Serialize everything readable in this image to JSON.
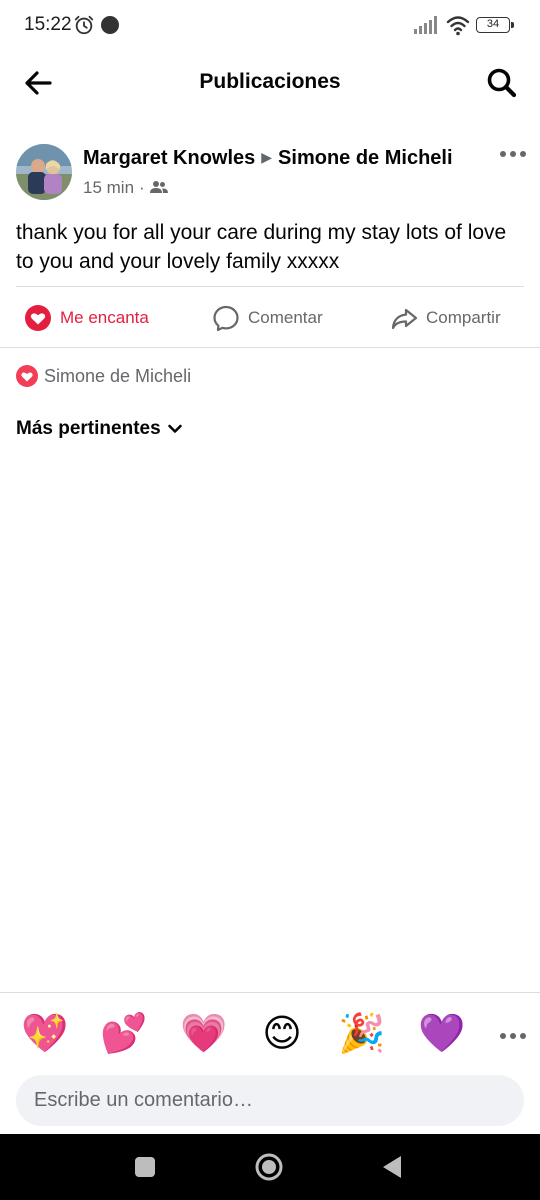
{
  "status_bar": {
    "time": "15:22",
    "battery": "34",
    "icons": [
      "alarm-icon",
      "notification-dot-icon",
      "signal-icon",
      "wifi-icon",
      "battery-icon"
    ]
  },
  "header": {
    "title": "Publicaciones",
    "back_icon": "arrow-left-icon",
    "search_icon": "search-icon"
  },
  "post": {
    "author": "Margaret Knowles",
    "target": "Simone de Micheli",
    "time": "15 min",
    "separator": "·",
    "audience_icon": "friends-icon",
    "text": "thank you for all your care during my stay lots of love to you and your lovely family xxxxx"
  },
  "actions": {
    "love_label": "Me encanta",
    "comment_label": "Comentar",
    "share_label": "Compartir"
  },
  "reactions": {
    "names": "Simone de Micheli"
  },
  "comments_sort": {
    "label": "Más pertinentes"
  },
  "quick_reactions": [
    "💖",
    "💕",
    "💗",
    "😊",
    "🎉",
    "💜"
  ],
  "comment_input": {
    "placeholder": "Escribe un comentario…"
  },
  "colors": {
    "accent_love": "#e41e3f",
    "secondary_text": "#65676b",
    "divider": "#dadde1",
    "input_bg": "#f0f2f5"
  }
}
